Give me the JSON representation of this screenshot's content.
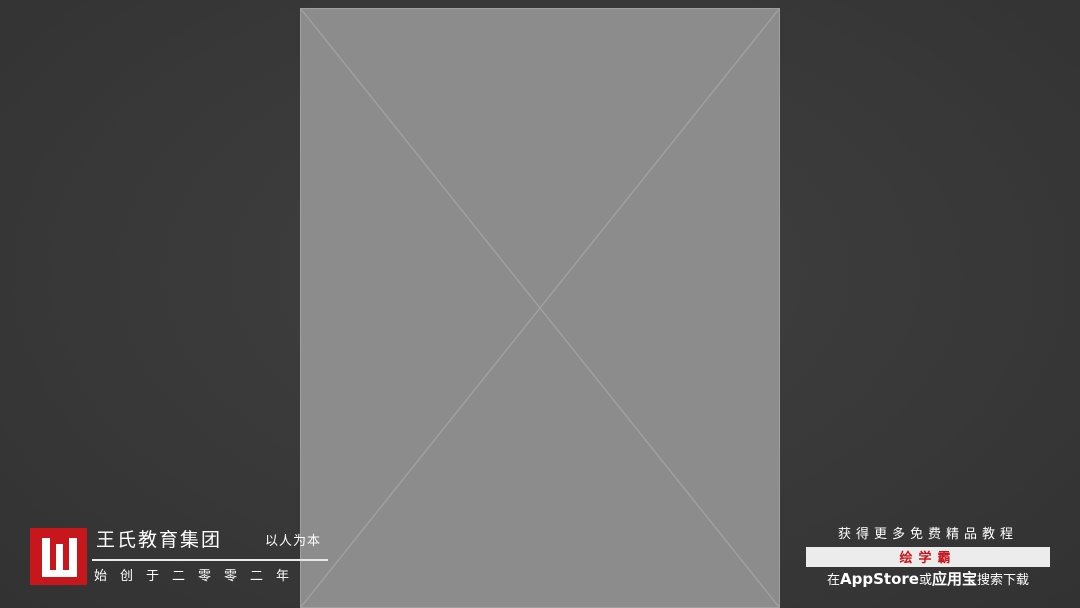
{
  "canvas": {
    "background": "#3a3a3a"
  },
  "brand": {
    "logo_color": "#c8161d",
    "name": "王氏教育集团",
    "motto": "以人为本",
    "founded": "始创于二零零二年"
  },
  "promo": {
    "top": "获得更多免费精品教程",
    "app_name": "绘学霸",
    "pre": "在",
    "store1": "AppStore",
    "mid": "或",
    "store2": "应用宝",
    "post": "搜索下载"
  }
}
